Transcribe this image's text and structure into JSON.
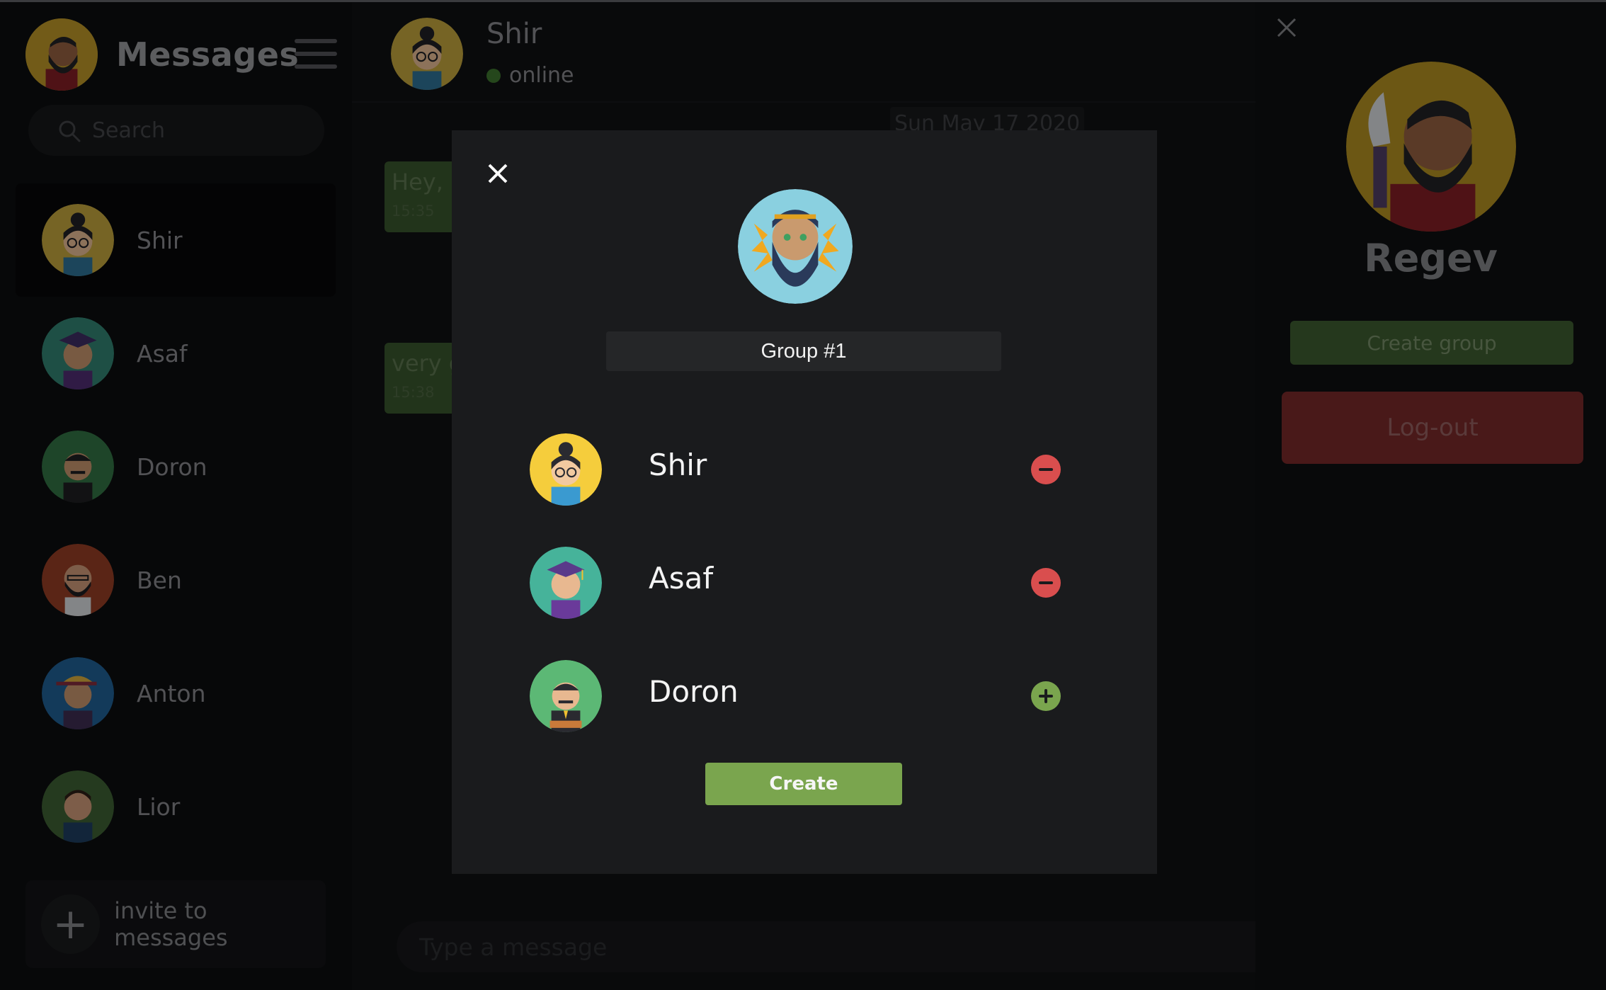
{
  "sidebar": {
    "title": "Messages",
    "search_placeholder": "Search",
    "contacts": [
      {
        "name": "Shir",
        "active": true
      },
      {
        "name": "Asaf"
      },
      {
        "name": "Doron"
      },
      {
        "name": "Ben"
      },
      {
        "name": "Anton"
      },
      {
        "name": "Lior"
      }
    ],
    "invite_label": "invite to messages"
  },
  "chat": {
    "name": "Shir",
    "status": "online",
    "date": "Sun May 17 2020",
    "messages": [
      {
        "text": "Hey,",
        "time": "15:35"
      },
      {
        "text": "very g",
        "time": "15:38"
      }
    ],
    "composer_placeholder": "Type a message"
  },
  "profile": {
    "name": "Regev",
    "create_group_label": "Create group",
    "logout_label": "Log-out"
  },
  "modal": {
    "group_name": "Group #1",
    "members": [
      {
        "name": "Shir",
        "action": "remove"
      },
      {
        "name": "Asaf",
        "action": "remove"
      },
      {
        "name": "Doron",
        "action": "add"
      }
    ],
    "create_label": "Create"
  },
  "colors": {
    "accent_green": "#7aa54e",
    "remove_red": "#d94e4e",
    "logout_red": "#712727"
  }
}
